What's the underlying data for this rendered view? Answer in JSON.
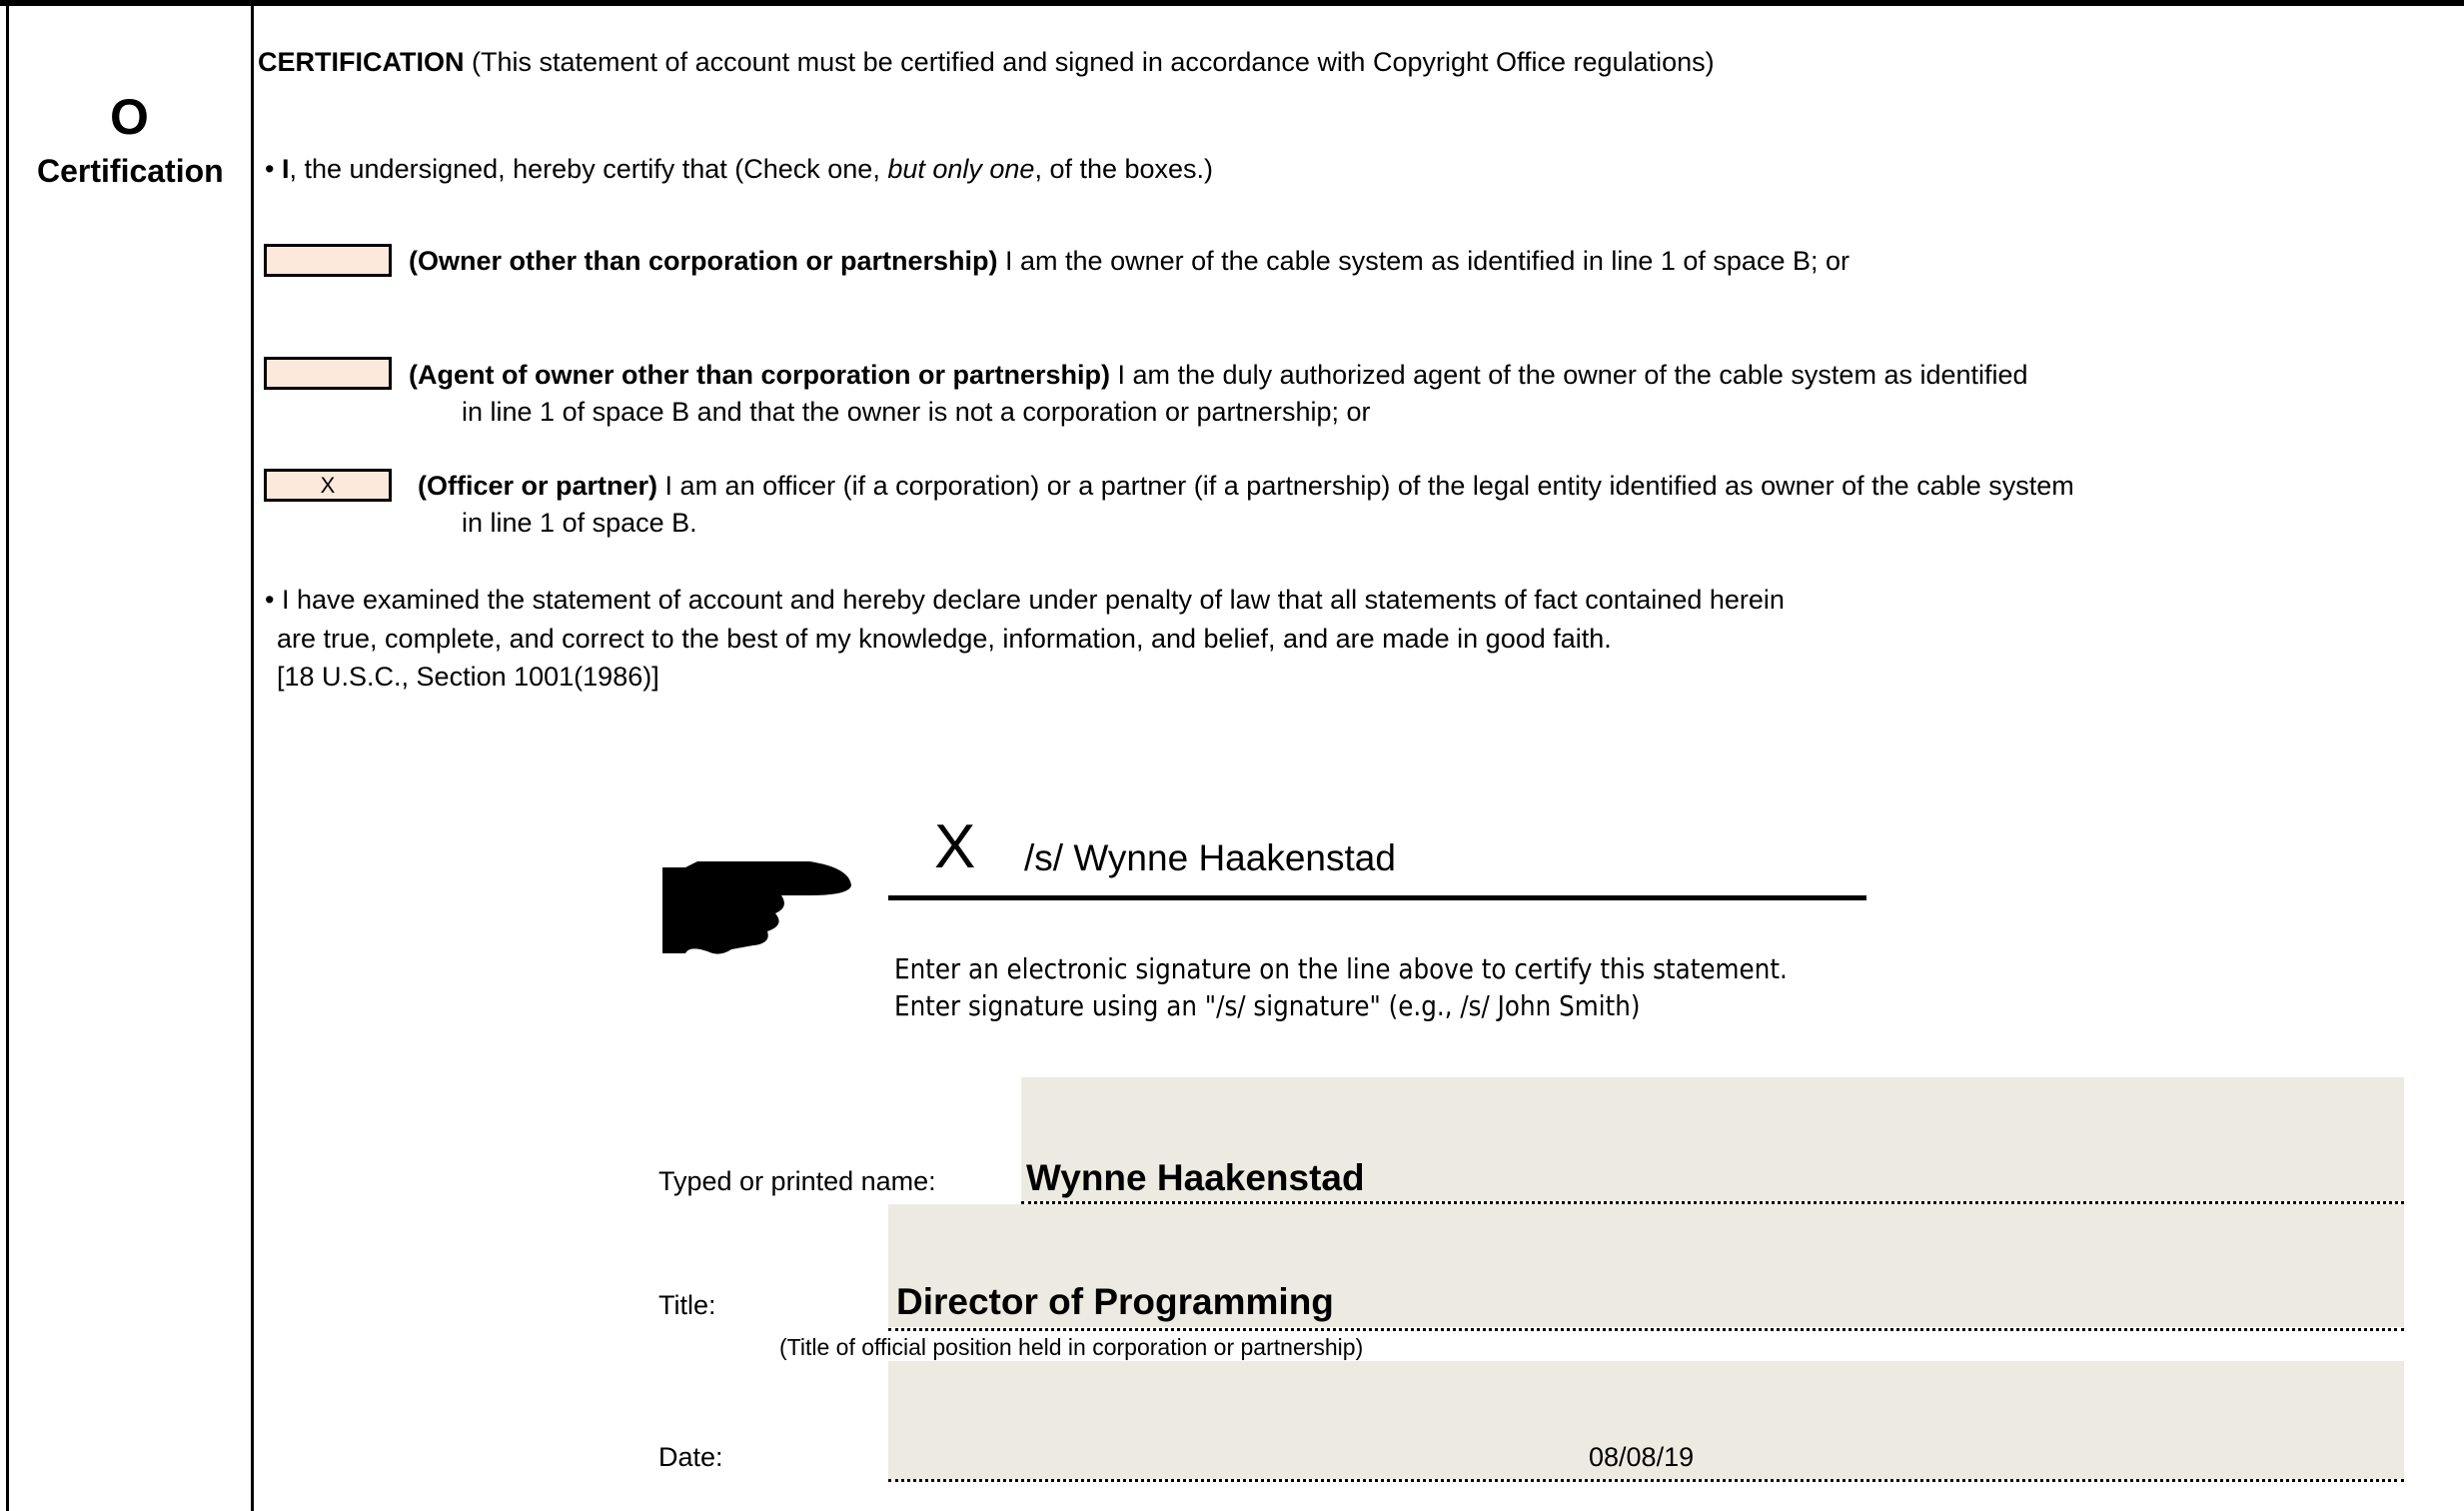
{
  "section": {
    "letter": "O",
    "name": "Certification"
  },
  "heading": {
    "bold": "CERTIFICATION",
    "rest": " (This statement of account must be certified and signed in accordance with Copyright Office regulations)"
  },
  "intro": {
    "bullet": "•",
    "bold": "I",
    "pre": ", the undersigned, hereby certify that (Check one, ",
    "italic": "but only one",
    "post": ", of the boxes.)"
  },
  "options": [
    {
      "checked": "",
      "bold": "(Owner other than corporation or partnership)",
      "text": " I am the owner of the cable system as identified in line 1 of space B; or",
      "line2": ""
    },
    {
      "checked": "",
      "bold": "(Agent of owner other than corporation or partnership)",
      "text": " I am the duly authorized agent of the owner of the cable system as identified",
      "line2": "in line 1 of space B and that the owner is not a corporation or partnership; or"
    },
    {
      "checked": "X",
      "bold": "(Officer or partner)",
      "text": " I am an officer (if a corporation) or a partner (if a partnership) of the legal entity identified as owner of the cable system",
      "line2": "in line 1 of space B."
    }
  ],
  "declaration": {
    "bullet": "•",
    "line1": "I have examined the statement of account and hereby declare under penalty of law that all statements of fact contained herein",
    "line2": "are true, complete, and correct to the best of my knowledge, information, and belief, and are made in good faith.",
    "line3": "[18 U.S.C., Section 1001(1986)]"
  },
  "signature": {
    "mark": "X",
    "value": "/s/ Wynne Haakenstad",
    "instruction1": "Enter an electronic signature on the line above to certify this statement.",
    "instruction2": "Enter signature using an \"/s/ signature\" (e.g.,  /s/ John Smith)",
    "icon": "pointing-hand-icon"
  },
  "fields": {
    "name_label": "Typed or printed name:",
    "name_value": "Wynne Haakenstad",
    "title_label": "Title:",
    "title_value": "Director of Programming",
    "title_hint": "(Title of official position held in corporation or partnership)",
    "date_label": "Date:",
    "date_value": "08/08/19"
  },
  "colors": {
    "checkbox_fill": "#fde9dc",
    "field_fill": "#edebe1"
  }
}
